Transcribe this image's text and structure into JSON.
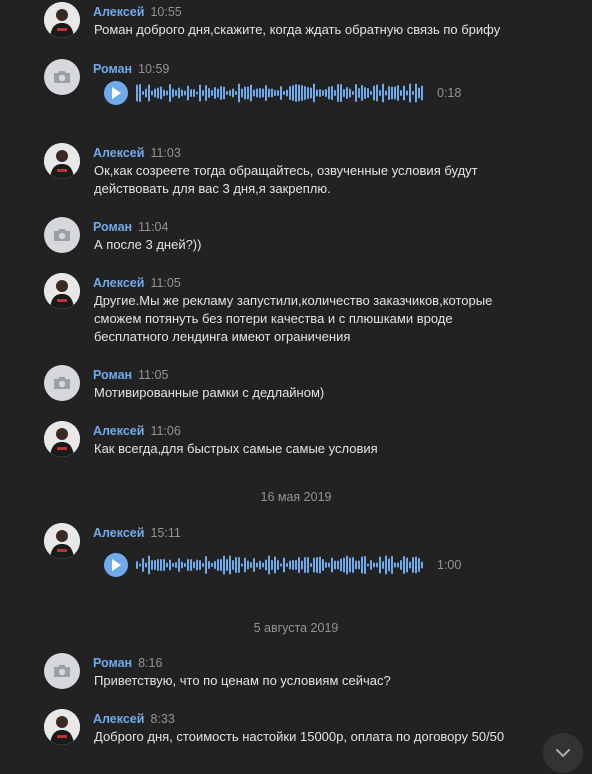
{
  "colors": {
    "background": "#222222",
    "author": "#71aaeb",
    "time": "#939393",
    "text": "#e1e3e6",
    "accent": "#71aaeb"
  },
  "messages": [
    {
      "author": "Алексей",
      "time": "10:55",
      "avatar": "photo",
      "text": "Роман доброго дня,скажите, когда ждать обратную связь по брифу"
    },
    {
      "author": "Роман",
      "time": "10:59",
      "avatar": "camera-icon",
      "voice": {
        "duration": "0:18",
        "play_icon": "play-icon"
      }
    },
    {
      "author": "Алексей",
      "time": "11:03",
      "avatar": "photo",
      "text": "Ок,как созреете тогда обращайтесь, озвученные условия будут действовать для вас 3 дня,я закреплю."
    },
    {
      "author": "Роман",
      "time": "11:04",
      "avatar": "camera-icon",
      "text": "А после 3 дней?))"
    },
    {
      "author": "Алексей",
      "time": "11:05",
      "avatar": "photo",
      "text": "Другие.Мы же рекламу запустили,количество заказчиков,которые сможем потянуть без потери качества и с плюшками вроде бесплатного лендинга имеют ограничения"
    },
    {
      "author": "Роман",
      "time": "11:05",
      "avatar": "camera-icon",
      "text": "Мотивированные рамки с дедлайном)"
    },
    {
      "author": "Алексей",
      "time": "11:06",
      "avatar": "photo",
      "text": "Как всегда,для быстрых самые самые условия"
    },
    {
      "author": "Алексей",
      "time": "15:11",
      "avatar": "photo",
      "voice": {
        "duration": "1:00",
        "play_icon": "play-icon"
      }
    },
    {
      "author": "Роман",
      "time": "8:16",
      "avatar": "camera-icon",
      "text": "Приветствую, что по ценам по условиям сейчас?"
    },
    {
      "author": "Алексей",
      "time": "8:33",
      "avatar": "photo",
      "text": "Доброго дня, стоимость настойки 15000р, оплата по договору 50/50"
    }
  ],
  "date_separators": [
    "16 мая 2019",
    "5 августа 2019"
  ],
  "scroll_down_icon": "chevron-down-icon"
}
